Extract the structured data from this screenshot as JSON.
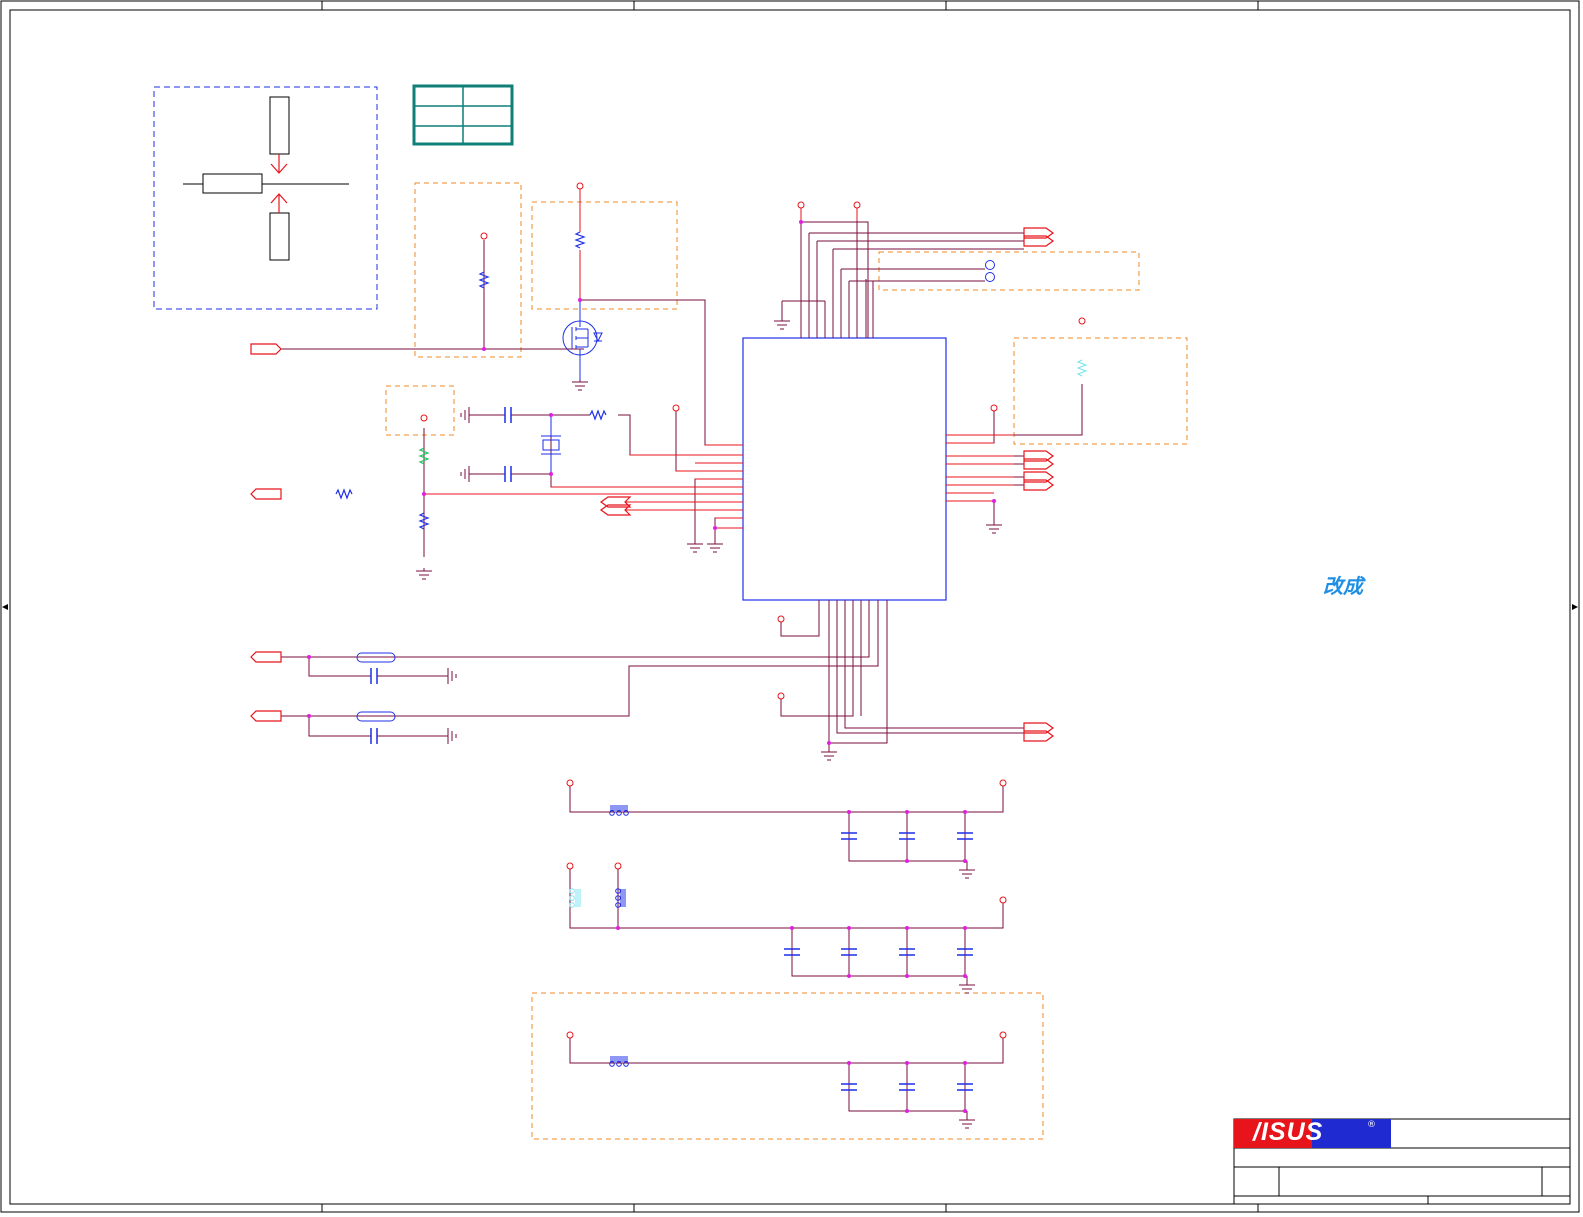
{
  "annotation": {
    "text": "改成"
  },
  "logo": {
    "text": "/ISUS",
    "mark": "®"
  },
  "colors": {
    "border": "#000000",
    "wire": "#7a0f3c",
    "wire_red": "#e8141b",
    "wire_blue": "#1a1ad6",
    "box_orange": "#f08a24",
    "box_blue": "#1f2fe8",
    "junction": "#e020e0",
    "annotation": "#1f8fe6",
    "table_teal": "#0f7f78",
    "logo_red": "#e8141b",
    "logo_blue": "#1f2ad0"
  }
}
